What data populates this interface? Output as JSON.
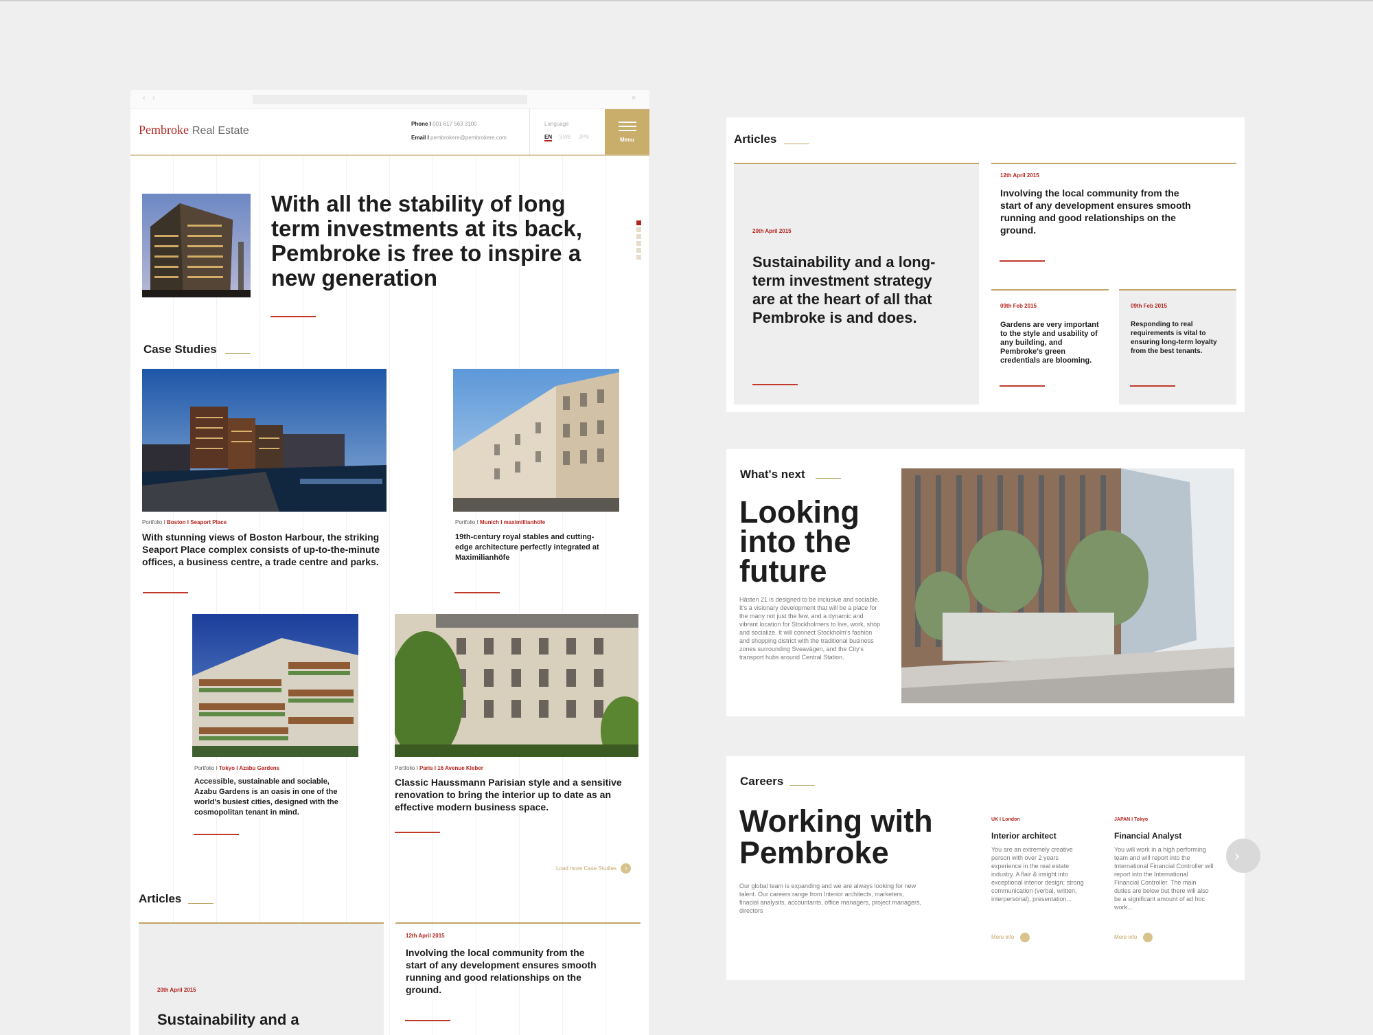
{
  "site": {
    "brand_main": "Pembroke",
    "brand_sub": "Real Estate",
    "phone_label": "Phone I",
    "phone_value": "001 617 563 3100",
    "email_label": "Email I",
    "email_value": "pembrokere@pembrokere.com",
    "language_label": "Language",
    "languages": [
      "EN",
      "SWE",
      "JPN"
    ],
    "menu_label": "Menu"
  },
  "hero": {
    "title": "With all the stability of long term investments at its back, Pembroke is free to inspire a new generation"
  },
  "case_studies": {
    "heading": "Case Studies",
    "items": [
      {
        "prefix": "Portfolio I ",
        "location": "Boston I Seaport Place",
        "text": "With stunning views of Boston Harbour, the striking Seaport Place complex consists of up-to-the-minute offices, a business centre, a trade centre and parks."
      },
      {
        "prefix": "Portfolio I ",
        "location": "Munich I maximillianhöfe",
        "text": "19th-century royal stables and cutting-edge architecture perfectly integrated at Maximilianhöfe"
      },
      {
        "prefix": "Portfolio I ",
        "location": "Tokyo I Azabu Gardens",
        "text": "Accessible, sustainable and sociable, Azabu Gardens is an oasis in one of the world's busiest cities, designed with the cosmopolitan tenant in mind."
      },
      {
        "prefix": "Portfolio I ",
        "location": "Paris I 16 Avenue Kleber",
        "text": "Classic Haussmann Parisian style and a sensitive renovation to bring the interior up to date as an effective modern business space."
      }
    ],
    "load_more": "Load more Case Studies"
  },
  "articles": {
    "heading": "Articles",
    "items": [
      {
        "date": "20th April 2015",
        "text": "Sustainability and a long-term investment strategy are at the heart of all that Pembroke is and does."
      },
      {
        "date": "12th April 2015",
        "text": "Involving the local community from the start of any development ensures smooth running and good relationships on the ground."
      },
      {
        "date": "09th Feb 2015",
        "text": "Gardens are very important to the style and usability of any building, and Pembroke's green credentials are blooming."
      },
      {
        "date": "09th Feb 2015",
        "text": "Responding to real requirements is vital to ensuring long-term loyalty from the best tenants."
      }
    ],
    "partial_text": "Sustainability and a"
  },
  "whats_next": {
    "heading": "What's next",
    "title": "Looking into the future",
    "body": "Hästen 21 is designed to be inclusive and sociable. It's a visionary development that will be a place for the many not just the few, and a dynamic and vibrant location for Stockholmers to live, work, shop and socialize. It will connect Stockholm's fashion and shopping district with the traditional business zones surrounding Sveavägen, and the City's transport hubs around Central Station."
  },
  "careers": {
    "heading": "Careers",
    "title": "Working with Pembroke",
    "body": "Our global team is expanding and we are always looking for new talent. Our careers range from Interior architects, marketers, finacial analysits, accountants, office managers, project managers, directors",
    "jobs": [
      {
        "location": "UK I London",
        "title": "Interior architect",
        "text": "You are an extremely creative person with over 2 years experience in the real estate industry. A flair & insight into exceptional interior design; strong communication (verbal, written, interpersonal), presentation...",
        "more": "More info"
      },
      {
        "location": "JAPAN I Tokyo",
        "title": "Financial Analyst",
        "text": "You will work in a high performing team and will report into the International Financial Controller will report into the International Financial Controller. The main duties are below but there will also be a significant amount of ad hoc work...",
        "more": "More info"
      }
    ]
  },
  "colors": {
    "accent_red": "#b3241f",
    "accent_gold": "#c2a567",
    "menu_bg": "#c9ad6a"
  }
}
